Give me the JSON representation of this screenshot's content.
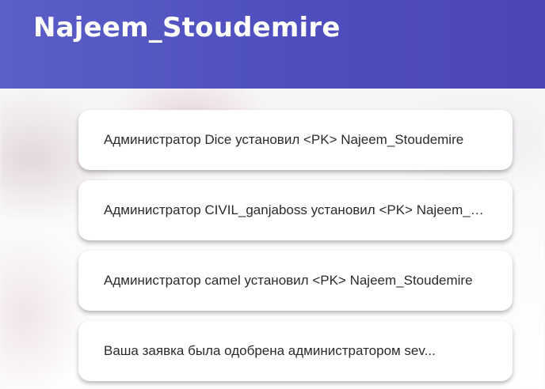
{
  "header": {
    "title": "Najeem_Stoudemire"
  },
  "notifications": [
    {
      "text": "Администратор Dice установил <PK> Najeem_Stoudemire"
    },
    {
      "text": "Администратор CIVIL_ganjaboss установил <PK> Najeem_Stoudemire"
    },
    {
      "text": "Администратор camel установил <PK> Najeem_Stoudemire"
    },
    {
      "text": "Ваша заявка была одобрена администратором sev..."
    }
  ],
  "colors": {
    "header_start": "#5b5fc7",
    "header_end": "#4c46b6",
    "card_background": "#ffffff",
    "text": "#2b2b2b"
  }
}
